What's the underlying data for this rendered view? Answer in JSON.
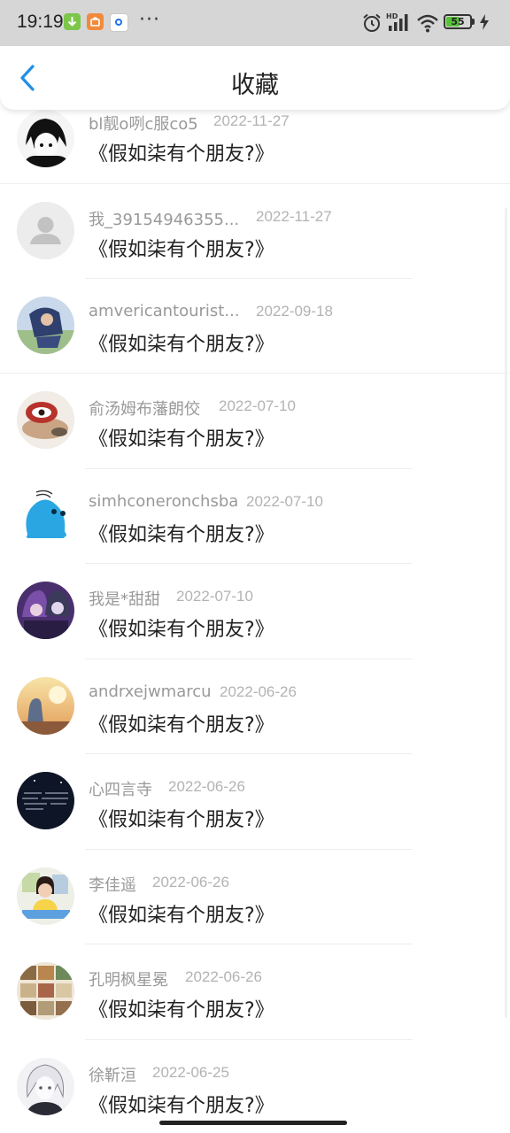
{
  "status_bar": {
    "time": "19:19",
    "more": "···",
    "battery": "55",
    "icons": [
      "alarm-icon",
      "hd-signal-icon",
      "wifi-icon",
      "battery-icon",
      "charging-icon"
    ],
    "app_icons": [
      "download-app-icon",
      "shop-app-icon",
      "browser-app-icon"
    ]
  },
  "header": {
    "title": "收藏",
    "back_icon": "chevron-left-icon",
    "accent_color": "#1e8fe8"
  },
  "items": [
    {
      "user": "bl靓o咧c服co5",
      "date": "2022-11-27",
      "title": "《假如柒有个朋友?》",
      "avatar": "anime-avatar"
    },
    {
      "user": "我_39154946355...",
      "date": "2022-11-27",
      "title": "《假如柒有个朋友?》",
      "avatar": "default-avatar"
    },
    {
      "user": "amvericantourist...",
      "date": "2022-09-18",
      "title": "《假如柒有个朋友?》",
      "avatar": "photo-avatar"
    },
    {
      "user": "俞汤姆布藩朗佼",
      "date": "2022-07-10",
      "title": "《假如柒有个朋友?》",
      "avatar": "cartoon-avatar"
    },
    {
      "user": "simhconeronchsba",
      "date": "2022-07-10",
      "title": "《假如柒有个朋友?》",
      "avatar": "blue-cartoon-avatar"
    },
    {
      "user": "我是*甜甜",
      "date": "2022-07-10",
      "title": "《假如柒有个朋友?》",
      "avatar": "anime-couple-avatar"
    },
    {
      "user": "andrxejwmarcu",
      "date": "2022-06-26",
      "title": "《假如柒有个朋友?》",
      "avatar": "sunset-avatar"
    },
    {
      "user": "心四言寺",
      "date": "2022-06-26",
      "title": "《假如柒有个朋友?》",
      "avatar": "night-text-avatar"
    },
    {
      "user": "李佳遥",
      "date": "2022-06-26",
      "title": "《假如柒有个朋友?》",
      "avatar": "child-photo-avatar"
    },
    {
      "user": "孔明枫星冕",
      "date": "2022-06-26",
      "title": "《假如柒有个朋友?》",
      "avatar": "collage-avatar"
    },
    {
      "user": "徐靳洹",
      "date": "2022-06-25",
      "title": "《假如柒有个朋友?》",
      "avatar": "white-hair-anime-avatar"
    }
  ]
}
